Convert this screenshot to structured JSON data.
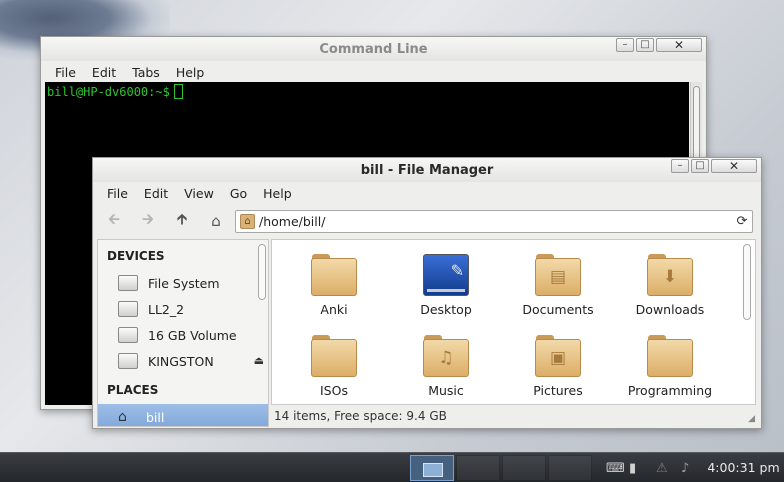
{
  "terminal": {
    "title": "Command Line",
    "menu": [
      "File",
      "Edit",
      "Tabs",
      "Help"
    ],
    "prompt": "bill@HP-dv6000:~$"
  },
  "file_manager": {
    "title": "bill - File Manager",
    "menu": [
      "File",
      "Edit",
      "View",
      "Go",
      "Help"
    ],
    "location": "/home/bill/",
    "sidebar": {
      "devices_heading": "DEVICES",
      "devices": [
        "File System",
        "LL2_2",
        "16 GB Volume",
        "KINGSTON"
      ],
      "places_heading": "PLACES",
      "places": [
        "bill"
      ]
    },
    "files": [
      {
        "name": "Anki",
        "icon": "folder-icon"
      },
      {
        "name": "Desktop",
        "icon": "desktop-folder-icon"
      },
      {
        "name": "Documents",
        "icon": "documents-folder-icon"
      },
      {
        "name": "Downloads",
        "icon": "downloads-folder-icon"
      },
      {
        "name": "ISOs",
        "icon": "folder-icon"
      },
      {
        "name": "Music",
        "icon": "music-folder-icon"
      },
      {
        "name": "Pictures",
        "icon": "pictures-folder-icon"
      },
      {
        "name": "Programming",
        "icon": "folder-icon"
      }
    ],
    "status": "14 items, Free space: 9.4 GB"
  },
  "taskbar": {
    "clock": "4:00:31 pm"
  },
  "colors": {
    "terminal_text": "#2ec42e",
    "selection": "#7fa6d9",
    "folder": "#dcae68"
  }
}
